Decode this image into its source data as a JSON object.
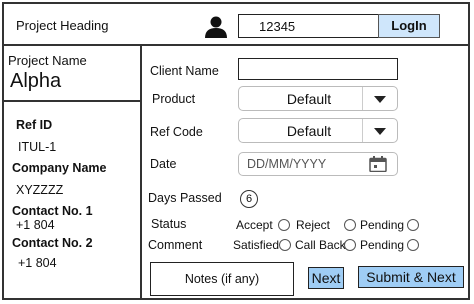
{
  "header": {
    "title": "Project Heading",
    "user_icon": "user-icon",
    "user_field_value": "12345",
    "login_label": "LogIn"
  },
  "sidebar": {
    "project_name_label": "Project Name",
    "project_name_value": "Alpha",
    "ref_id_label": "Ref ID",
    "ref_id_value": "ITUL-1",
    "company_label": "Company Name",
    "company_value": "XYZZZZ",
    "contact1_label": "Contact No. 1",
    "contact1_value": "+1 804",
    "contact2_label": "Contact No. 2",
    "contact2_value": "+1 804"
  },
  "form": {
    "client_name_label": "Client Name",
    "client_name_value": "",
    "product_label": "Product",
    "product_value": "Default",
    "ref_code_label": "Ref Code",
    "ref_code_value": "Default",
    "date_label": "Date",
    "date_placeholder": "DD/MM/YYYY",
    "calendar_icon": "calendar-icon",
    "days_passed_label": "Days Passed",
    "days_passed_value": "6",
    "status_label": "Status",
    "status_options": [
      "Accept",
      "Reject",
      "Pending"
    ],
    "comment_label": "Comment",
    "comment_options": [
      "Satisfied",
      "Call Back",
      "Pending"
    ]
  },
  "footer": {
    "notes_label": "Notes (if any)",
    "next_label": "Next",
    "submit_label": "Submit & Next"
  }
}
